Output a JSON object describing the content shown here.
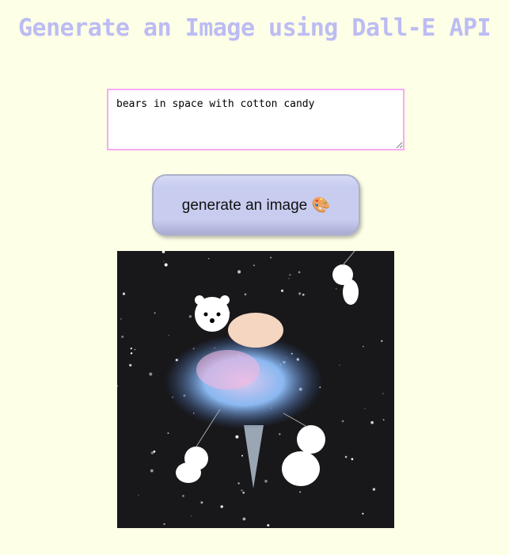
{
  "header": {
    "title": "Generate an Image using Dall-E API"
  },
  "prompt": {
    "value": "bears in space with cotton candy"
  },
  "generate_button": {
    "label": "generate an image 🎨"
  },
  "colors": {
    "background": "#fdffe6",
    "title": "#bcbcf4",
    "input_border": "#f7aaf5",
    "button": "#c8cdf0"
  }
}
